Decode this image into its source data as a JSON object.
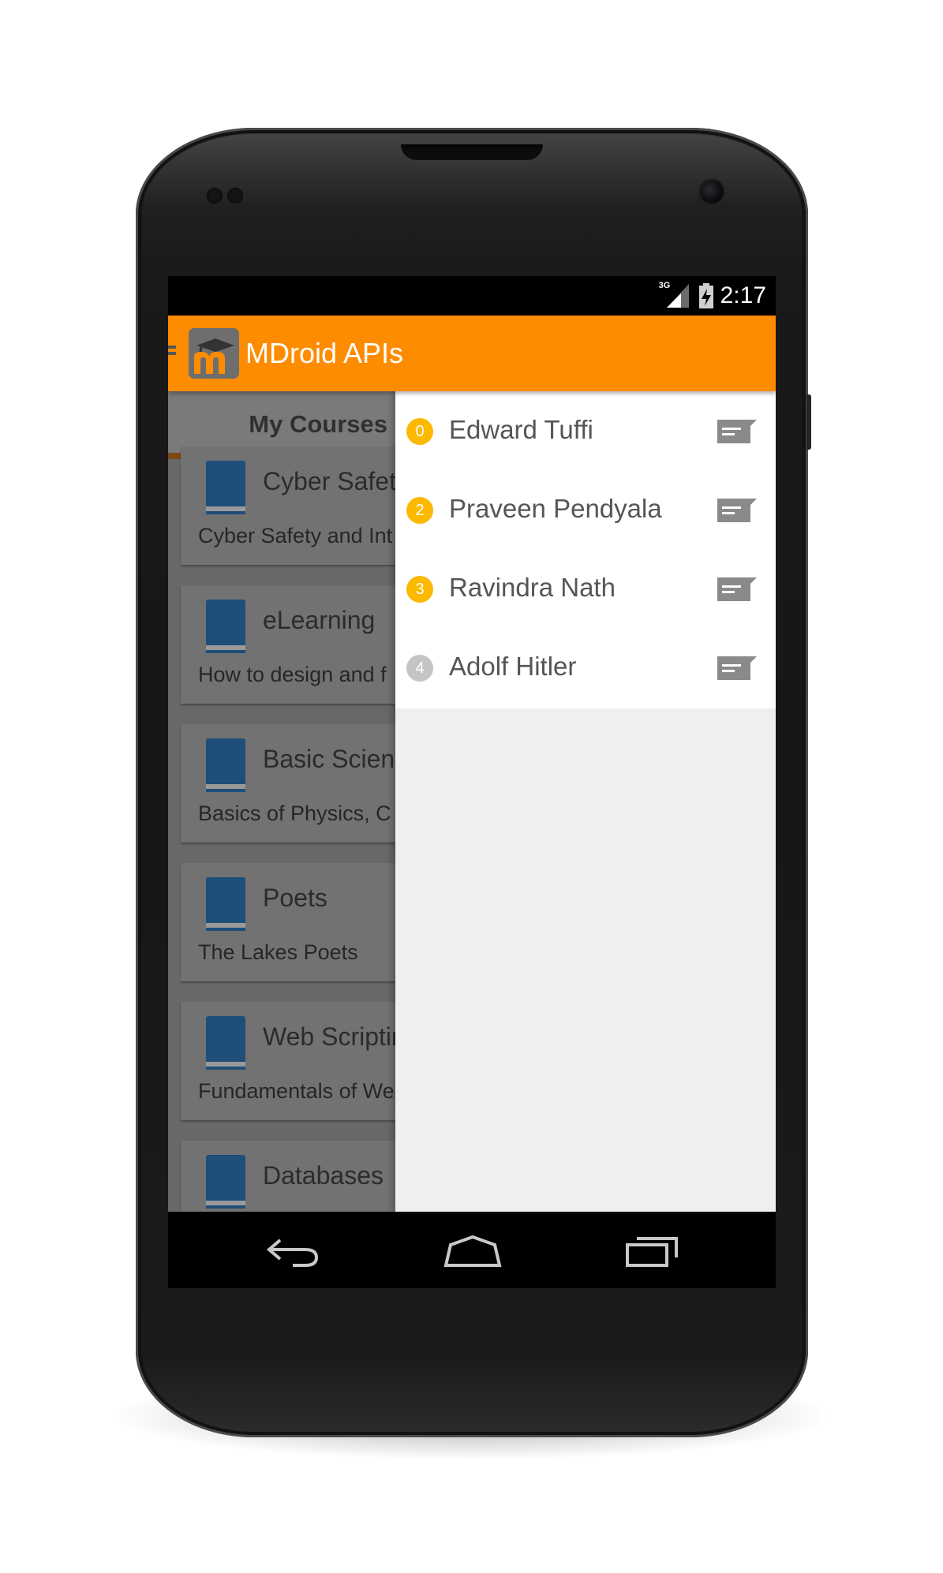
{
  "status_bar": {
    "network": "3G",
    "time": "2:17"
  },
  "app": {
    "title": "MDroid APIs",
    "logo_icon": "moodle-logo-icon"
  },
  "tabs": [
    {
      "label": "My Courses",
      "active": true
    }
  ],
  "courses": [
    {
      "title": "Cyber Safety",
      "description": "Cyber Safety and Int"
    },
    {
      "title": "eLearning",
      "description": "How to design and f"
    },
    {
      "title": "Basic Scien",
      "description": "Basics of Physics, C"
    },
    {
      "title": "Poets",
      "description": "The Lakes Poets"
    },
    {
      "title": "Web Scriptin",
      "description": "Fundamentals of We"
    },
    {
      "title": "Databases",
      "description": ""
    }
  ],
  "participants": [
    {
      "badge": "0",
      "name": "Edward Tuffi",
      "badge_color": "#fcb900"
    },
    {
      "badge": "2",
      "name": "Praveen Pendyala",
      "badge_color": "#fcb900"
    },
    {
      "badge": "3",
      "name": "Ravindra Nath",
      "badge_color": "#fcb900"
    },
    {
      "badge": "4",
      "name": "Adolf Hitler",
      "badge_color": "#c4c4c4"
    }
  ],
  "colors": {
    "accent": "#fd8c00",
    "badge": "#fcb900",
    "book": "#1f4e79"
  },
  "nav": {
    "back_icon": "back-icon",
    "home_icon": "home-icon",
    "recents_icon": "recents-icon"
  }
}
